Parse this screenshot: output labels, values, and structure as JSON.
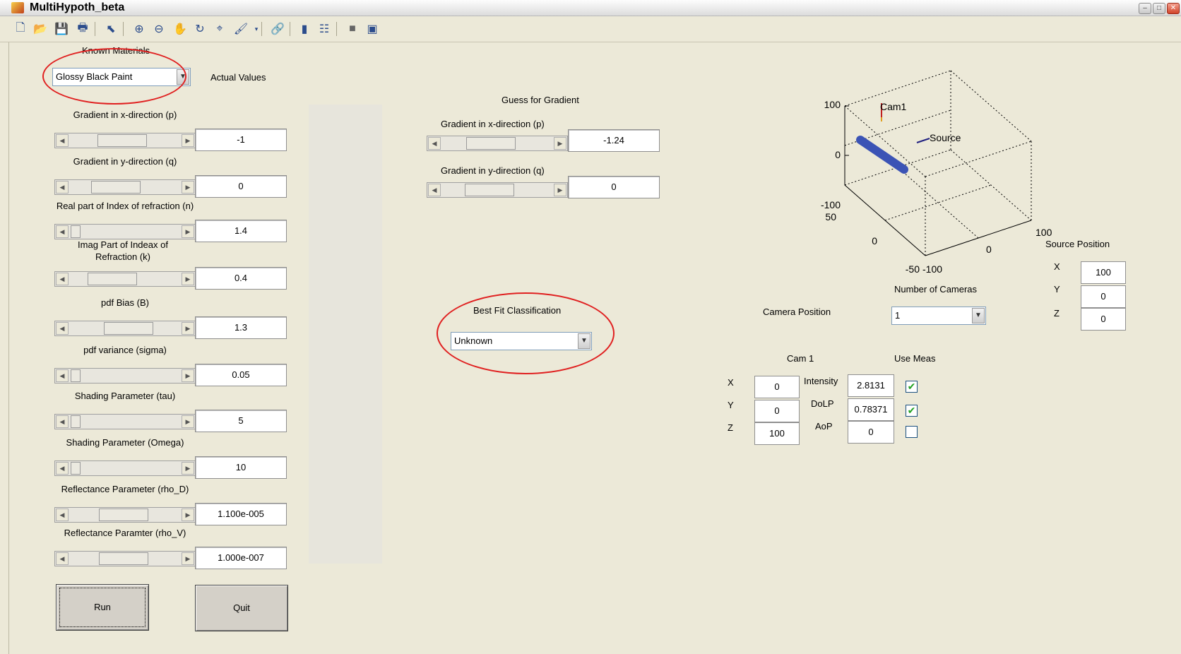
{
  "window": {
    "title": "MultiHypoth_beta",
    "min": "‒",
    "max": "□",
    "close": "✕"
  },
  "toolbar_icons": [
    "new-file-icon",
    "open-folder-icon",
    "save-icon",
    "print-icon",
    "pointer-icon",
    "zoom-in-icon",
    "zoom-out-icon",
    "pan-hand-icon",
    "rotate-3d-icon",
    "data-cursor-icon",
    "brush-icon",
    "link-icon",
    "colorbar-icon",
    "legend-icon",
    "hide-plot-tools-icon",
    "show-plot-tools-icon"
  ],
  "left": {
    "known_materials_label": "Known Materials",
    "material_selected": "Glossy Black Paint",
    "actual_values_label": "Actual Values",
    "params": [
      {
        "label": "Gradient in x-direction (p)",
        "value": "-1",
        "thumb": 0.45
      },
      {
        "label": "Gradient in y-direction (q)",
        "value": "0",
        "thumb": 0.35
      },
      {
        "label": "Real part of Index of refraction (n)",
        "value": "1.4",
        "thumb": 0.02
      },
      {
        "label": "Imag Part of Indeax of Refraction (k)",
        "value": "0.4",
        "thumb": 0.3
      },
      {
        "label": "pdf Bias (B)",
        "value": "1.3",
        "thumb": 0.55
      },
      {
        "label": "pdf variance (sigma)",
        "value": "0.05",
        "thumb": 0.02
      },
      {
        "label": "Shading Parameter (tau)",
        "value": "5",
        "thumb": 0.02
      },
      {
        "label": "Shading Parameter (Omega)",
        "value": "10",
        "thumb": 0.02
      },
      {
        "label": "Reflectance Parameter (rho_D)",
        "value": "1.100e-005",
        "thumb": 0.48
      },
      {
        "label": "Reflectance Paramter (rho_V)",
        "value": "1.000e-007",
        "thumb": 0.48
      }
    ],
    "run_label": "Run",
    "quit_label": "Quit"
  },
  "guess": {
    "title": "Guess for Gradient",
    "p_label": "Gradient in x-direction (p)",
    "p_value": "-1.24",
    "p_thumb": 0.4,
    "q_label": "Gradient in y-direction (q)",
    "q_value": "0",
    "q_thumb": 0.38
  },
  "bestfit": {
    "label": "Best Fit Classification",
    "selected": "Unknown"
  },
  "plot": {
    "z_ticks": [
      "100",
      "0",
      "-100"
    ],
    "y_ticks": [
      "50",
      "0",
      "-50"
    ],
    "x_ticks": [
      "-100",
      "0",
      "100"
    ],
    "cam_label": "Cam1",
    "source_label": "Source"
  },
  "source": {
    "title": "Source Position",
    "x_label": "X",
    "x_value": "100",
    "y_label": "Y",
    "y_value": "0",
    "z_label": "Z",
    "z_value": "0"
  },
  "cameras": {
    "number_label": "Number of Cameras",
    "position_label": "Camera Position",
    "selected": "1"
  },
  "cam1": {
    "title": "Cam 1",
    "use_meas_label": "Use Meas",
    "x_label": "X",
    "x_value": "0",
    "y_label": "Y",
    "y_value": "0",
    "z_label": "Z",
    "z_value": "100",
    "intensity_label": "Intensity",
    "intensity_value": "2.8131",
    "intensity_checked": true,
    "dolp_label": "DoLP",
    "dolp_value": "0.78371",
    "dolp_checked": true,
    "aop_label": "AoP",
    "aop_value": "0",
    "aop_checked": false
  }
}
